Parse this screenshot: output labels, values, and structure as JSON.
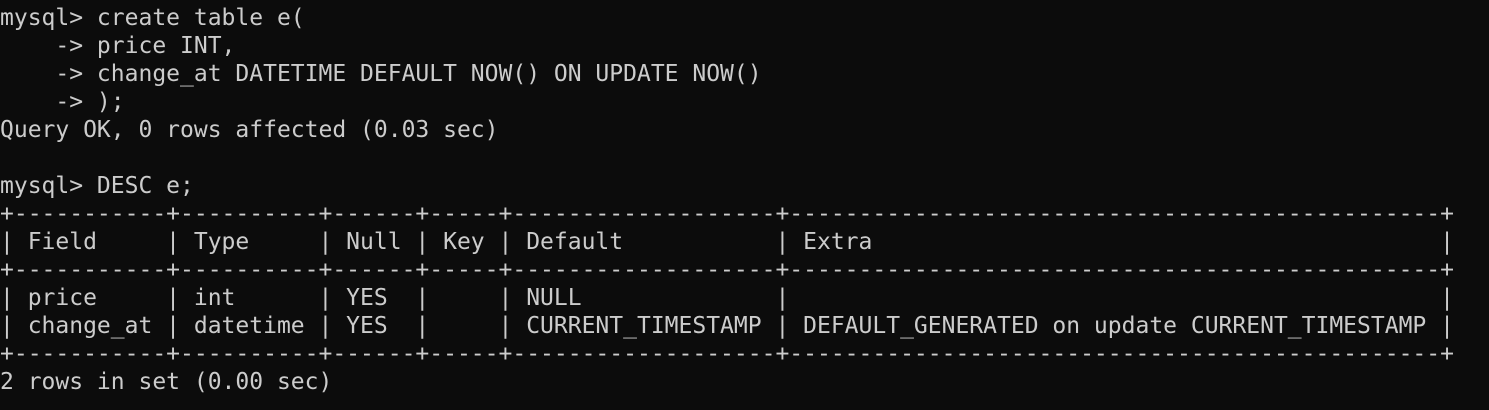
{
  "terminal": {
    "lines": [
      "mysql> create table e(",
      "    -> price INT,",
      "    -> change_at DATETIME DEFAULT NOW() ON UPDATE NOW()",
      "    -> );",
      "Query OK, 0 rows affected (0.03 sec)",
      "",
      "mysql> DESC e;",
      "+-----------+----------+------+-----+-------------------+-----------------------------------------------+",
      "| Field     | Type     | Null | Key | Default           | Extra                                         |",
      "+-----------+----------+------+-----+-------------------+-----------------------------------------------+",
      "| price     | int      | YES  |     | NULL              |                                               |",
      "| change_at | datetime | YES  |     | CURRENT_TIMESTAMP | DEFAULT_GENERATED on update CURRENT_TIMESTAMP |",
      "+-----------+----------+------+-----+-------------------+-----------------------------------------------+",
      "2 rows in set (0.00 sec)"
    ]
  }
}
